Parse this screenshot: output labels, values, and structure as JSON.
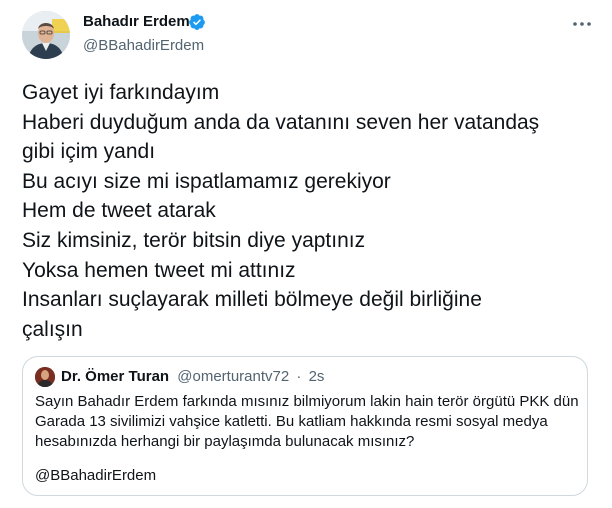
{
  "author": {
    "name": "Bahadır Erdem",
    "handle": "@BBahadirErdem",
    "verified": true
  },
  "icons": {
    "verified": "verified-badge-icon",
    "more": "more-options-icon",
    "avatar": "profile-avatar"
  },
  "colors": {
    "text": "#0f1419",
    "secondary": "#536471",
    "verified": "#1d9bf0",
    "border": "#cfd9de"
  },
  "tweet_lines": [
    "Gayet iyi farkındayım",
    "Haberi duyduğum anda da vatanını seven her vatandaş",
    "gibi içim yandı",
    "Bu acıyı size mi ispatlamamız gerekiyor",
    "Hem de tweet atarak",
    "Siz kimsiniz, terör bitsin diye yaptınız",
    "Yoksa hemen tweet mi attınız",
    "Insanları suçlayarak milleti bölmeye değil birliğine",
    "çalışın"
  ],
  "quoted": {
    "name": "Dr. Ömer Turan",
    "handle": "@omerturantv72",
    "separator": "·",
    "time": "2s",
    "lines": [
      "Sayın Bahadır Erdem farkında mısınız bilmiyorum lakin hain terör örgütü PKK dün",
      "Garada 13 sivilimizi vahşice katletti. Bu katliam hakkında resmi sosyal medya",
      "hesabınızda  herhangi bir paylaşımda bulunacak mısınız?"
    ],
    "mention": "@BBahadirErdem"
  }
}
